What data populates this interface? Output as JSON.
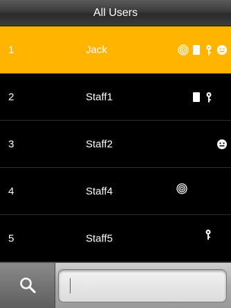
{
  "header": {
    "title": "All Users"
  },
  "users": [
    {
      "no": "1",
      "name": "Jack",
      "selected": true,
      "credentials": [
        "fingerprint-icon",
        "card-icon",
        "password-icon",
        "face-icon"
      ]
    },
    {
      "no": "2",
      "name": "Staff1",
      "selected": false,
      "credentials": [
        "card-icon",
        "password-icon"
      ]
    },
    {
      "no": "3",
      "name": "Staff2",
      "selected": false,
      "credentials": [
        "face-icon"
      ]
    },
    {
      "no": "4",
      "name": "Staff4",
      "selected": false,
      "credentials": [
        "fingerprint-icon"
      ]
    },
    {
      "no": "5",
      "name": "Staff5",
      "selected": false,
      "credentials": [
        "password-icon"
      ]
    }
  ],
  "search": {
    "value": ""
  },
  "colors": {
    "selected_row": "#ffb400",
    "background": "#000000"
  }
}
